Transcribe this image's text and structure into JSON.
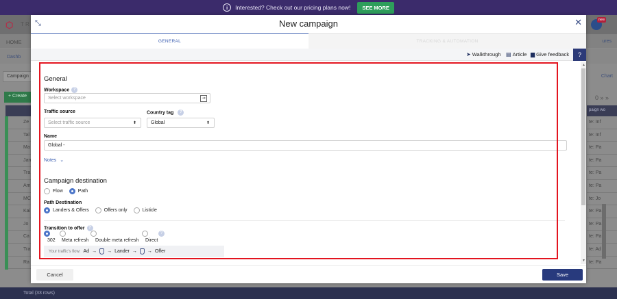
{
  "promo": {
    "message": "Interested?   Check out our pricing plans now!",
    "cta": "SEE MORE"
  },
  "background": {
    "brand": "T R",
    "nav_home": "HOME",
    "nav_right": "ures",
    "dashboard": "Dashb",
    "campaign_btn": "Campaign",
    "create_btn": "+ Create",
    "chart": "Chart",
    "badge": "new",
    "row_labels": [
      "Ze",
      "Tal",
      "Ma",
      "Jan",
      "Tra",
      "Am",
      "MC",
      "Kai",
      "Jo",
      "Ca",
      "Tra",
      "Ra"
    ],
    "right_head": "paign wo",
    "right_rows": [
      "te: Inf",
      "te: Inf",
      "te: Pa",
      "te: Pa",
      "te: Pa",
      "te: Pa",
      "te: Jo",
      "te: Pa",
      "te: Pa",
      "te: Pa",
      "te: Ad",
      "te: Pa"
    ],
    "footer": "Total (33 rows)"
  },
  "modal": {
    "title": "New campaign",
    "tabs": [
      "GENERAL",
      "TRACKING & AUTOMATION"
    ],
    "toolbar": {
      "walkthrough": "Walkthrough",
      "article": "Article",
      "feedback": "Give feedback",
      "help": "?"
    },
    "general": {
      "heading": "General",
      "workspace_label": "Workspace",
      "workspace_placeholder": "Select workspace",
      "traffic_source_label": "Traffic source",
      "traffic_source_placeholder": "Select traffic source",
      "country_tag_label": "Country tag",
      "country_tag_value": "Global",
      "name_label": "Name",
      "name_value": "Global -",
      "notes": "Notes"
    },
    "destination": {
      "heading": "Campaign destination",
      "options": [
        "Flow",
        "Path"
      ],
      "selected": "Path",
      "path_destination_label": "Path Destination",
      "path_options": [
        "Landers & Offers",
        "Offers only",
        "Listicle"
      ],
      "path_selected": "Landers & Offers"
    },
    "transition": {
      "label": "Transition to offer",
      "options": [
        "302",
        "Meta refresh",
        "Double meta refresh",
        "Direct"
      ],
      "selected": "302",
      "flow_label": "Your traffic's flow:",
      "flow_steps": [
        "Ad",
        "Lander",
        "Offer"
      ]
    },
    "footer": {
      "cancel": "Cancel",
      "save": "Save"
    }
  },
  "colors": {
    "accent": "#283a7d",
    "highlight": "#e3141f",
    "promo_bg": "#3b2b6b",
    "cta_bg": "#2e9e5b"
  }
}
